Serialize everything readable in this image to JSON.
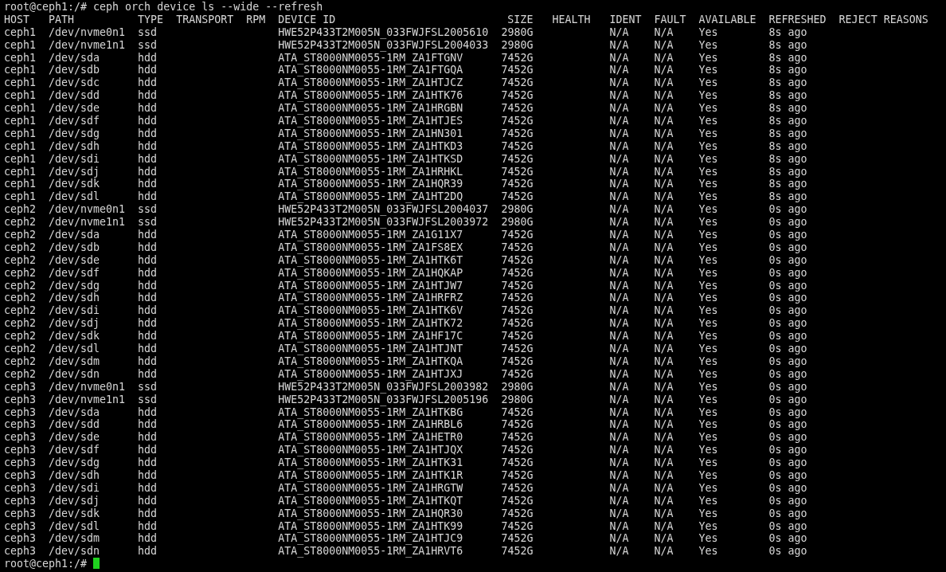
{
  "command": {
    "prompt": "root@ceph1:/#",
    "text": "ceph orch device ls --wide --refresh"
  },
  "columns": [
    "HOST",
    "PATH",
    "TYPE",
    "TRANSPORT",
    "RPM",
    "DEVICE ID",
    "SIZE",
    "HEALTH",
    "IDENT",
    "FAULT",
    "AVAILABLE",
    "REFRESHED",
    "REJECT REASONS"
  ],
  "rows": [
    {
      "host": "ceph1",
      "path": "/dev/nvme0n1",
      "type": "ssd",
      "device_id": "HWE52P433T2M005N_033FWJFSL2005610",
      "size": "2980G",
      "ident": "N/A",
      "fault": "N/A",
      "available": "Yes",
      "refreshed": "8s ago"
    },
    {
      "host": "ceph1",
      "path": "/dev/nvme1n1",
      "type": "ssd",
      "device_id": "HWE52P433T2M005N_033FWJFSL2004033",
      "size": "2980G",
      "ident": "N/A",
      "fault": "N/A",
      "available": "Yes",
      "refreshed": "8s ago"
    },
    {
      "host": "ceph1",
      "path": "/dev/sda",
      "type": "hdd",
      "device_id": "ATA_ST8000NM0055-1RM_ZA1FTGNV",
      "size": "7452G",
      "ident": "N/A",
      "fault": "N/A",
      "available": "Yes",
      "refreshed": "8s ago"
    },
    {
      "host": "ceph1",
      "path": "/dev/sdb",
      "type": "hdd",
      "device_id": "ATA_ST8000NM0055-1RM_ZA1FTGQA",
      "size": "7452G",
      "ident": "N/A",
      "fault": "N/A",
      "available": "Yes",
      "refreshed": "8s ago"
    },
    {
      "host": "ceph1",
      "path": "/dev/sdc",
      "type": "hdd",
      "device_id": "ATA_ST8000NM0055-1RM_ZA1HTJCZ",
      "size": "7452G",
      "ident": "N/A",
      "fault": "N/A",
      "available": "Yes",
      "refreshed": "8s ago"
    },
    {
      "host": "ceph1",
      "path": "/dev/sdd",
      "type": "hdd",
      "device_id": "ATA_ST8000NM0055-1RM_ZA1HTK76",
      "size": "7452G",
      "ident": "N/A",
      "fault": "N/A",
      "available": "Yes",
      "refreshed": "8s ago"
    },
    {
      "host": "ceph1",
      "path": "/dev/sde",
      "type": "hdd",
      "device_id": "ATA_ST8000NM0055-1RM_ZA1HRGBN",
      "size": "7452G",
      "ident": "N/A",
      "fault": "N/A",
      "available": "Yes",
      "refreshed": "8s ago"
    },
    {
      "host": "ceph1",
      "path": "/dev/sdf",
      "type": "hdd",
      "device_id": "ATA_ST8000NM0055-1RM_ZA1HTJES",
      "size": "7452G",
      "ident": "N/A",
      "fault": "N/A",
      "available": "Yes",
      "refreshed": "8s ago"
    },
    {
      "host": "ceph1",
      "path": "/dev/sdg",
      "type": "hdd",
      "device_id": "ATA_ST8000NM0055-1RM_ZA1HN301",
      "size": "7452G",
      "ident": "N/A",
      "fault": "N/A",
      "available": "Yes",
      "refreshed": "8s ago"
    },
    {
      "host": "ceph1",
      "path": "/dev/sdh",
      "type": "hdd",
      "device_id": "ATA_ST8000NM0055-1RM_ZA1HTKD3",
      "size": "7452G",
      "ident": "N/A",
      "fault": "N/A",
      "available": "Yes",
      "refreshed": "8s ago"
    },
    {
      "host": "ceph1",
      "path": "/dev/sdi",
      "type": "hdd",
      "device_id": "ATA_ST8000NM0055-1RM_ZA1HTKSD",
      "size": "7452G",
      "ident": "N/A",
      "fault": "N/A",
      "available": "Yes",
      "refreshed": "8s ago"
    },
    {
      "host": "ceph1",
      "path": "/dev/sdj",
      "type": "hdd",
      "device_id": "ATA_ST8000NM0055-1RM_ZA1HRHKL",
      "size": "7452G",
      "ident": "N/A",
      "fault": "N/A",
      "available": "Yes",
      "refreshed": "8s ago"
    },
    {
      "host": "ceph1",
      "path": "/dev/sdk",
      "type": "hdd",
      "device_id": "ATA_ST8000NM0055-1RM_ZA1HQR39",
      "size": "7452G",
      "ident": "N/A",
      "fault": "N/A",
      "available": "Yes",
      "refreshed": "8s ago"
    },
    {
      "host": "ceph1",
      "path": "/dev/sdl",
      "type": "hdd",
      "device_id": "ATA_ST8000NM0055-1RM_ZA1HT2DQ",
      "size": "7452G",
      "ident": "N/A",
      "fault": "N/A",
      "available": "Yes",
      "refreshed": "8s ago"
    },
    {
      "host": "ceph2",
      "path": "/dev/nvme0n1",
      "type": "ssd",
      "device_id": "HWE52P433T2M005N_033FWJFSL2004037",
      "size": "2980G",
      "ident": "N/A",
      "fault": "N/A",
      "available": "Yes",
      "refreshed": "0s ago"
    },
    {
      "host": "ceph2",
      "path": "/dev/nvme1n1",
      "type": "ssd",
      "device_id": "HWE52P433T2M005N_033FWJFSL2003972",
      "size": "2980G",
      "ident": "N/A",
      "fault": "N/A",
      "available": "Yes",
      "refreshed": "0s ago"
    },
    {
      "host": "ceph2",
      "path": "/dev/sda",
      "type": "hdd",
      "device_id": "ATA_ST8000NM0055-1RM_ZA1G11X7",
      "size": "7452G",
      "ident": "N/A",
      "fault": "N/A",
      "available": "Yes",
      "refreshed": "0s ago"
    },
    {
      "host": "ceph2",
      "path": "/dev/sdb",
      "type": "hdd",
      "device_id": "ATA_ST8000NM0055-1RM_ZA1FS8EX",
      "size": "7452G",
      "ident": "N/A",
      "fault": "N/A",
      "available": "Yes",
      "refreshed": "0s ago"
    },
    {
      "host": "ceph2",
      "path": "/dev/sde",
      "type": "hdd",
      "device_id": "ATA_ST8000NM0055-1RM_ZA1HTK6T",
      "size": "7452G",
      "ident": "N/A",
      "fault": "N/A",
      "available": "Yes",
      "refreshed": "0s ago"
    },
    {
      "host": "ceph2",
      "path": "/dev/sdf",
      "type": "hdd",
      "device_id": "ATA_ST8000NM0055-1RM_ZA1HQKAP",
      "size": "7452G",
      "ident": "N/A",
      "fault": "N/A",
      "available": "Yes",
      "refreshed": "0s ago"
    },
    {
      "host": "ceph2",
      "path": "/dev/sdg",
      "type": "hdd",
      "device_id": "ATA_ST8000NM0055-1RM_ZA1HTJW7",
      "size": "7452G",
      "ident": "N/A",
      "fault": "N/A",
      "available": "Yes",
      "refreshed": "0s ago"
    },
    {
      "host": "ceph2",
      "path": "/dev/sdh",
      "type": "hdd",
      "device_id": "ATA_ST8000NM0055-1RM_ZA1HRFRZ",
      "size": "7452G",
      "ident": "N/A",
      "fault": "N/A",
      "available": "Yes",
      "refreshed": "0s ago"
    },
    {
      "host": "ceph2",
      "path": "/dev/sdi",
      "type": "hdd",
      "device_id": "ATA_ST8000NM0055-1RM_ZA1HTK6V",
      "size": "7452G",
      "ident": "N/A",
      "fault": "N/A",
      "available": "Yes",
      "refreshed": "0s ago"
    },
    {
      "host": "ceph2",
      "path": "/dev/sdj",
      "type": "hdd",
      "device_id": "ATA_ST8000NM0055-1RM_ZA1HTK72",
      "size": "7452G",
      "ident": "N/A",
      "fault": "N/A",
      "available": "Yes",
      "refreshed": "0s ago"
    },
    {
      "host": "ceph2",
      "path": "/dev/sdk",
      "type": "hdd",
      "device_id": "ATA_ST8000NM0055-1RM_ZA1HF17C",
      "size": "7452G",
      "ident": "N/A",
      "fault": "N/A",
      "available": "Yes",
      "refreshed": "0s ago"
    },
    {
      "host": "ceph2",
      "path": "/dev/sdl",
      "type": "hdd",
      "device_id": "ATA_ST8000NM0055-1RM_ZA1HTJNT",
      "size": "7452G",
      "ident": "N/A",
      "fault": "N/A",
      "available": "Yes",
      "refreshed": "0s ago"
    },
    {
      "host": "ceph2",
      "path": "/dev/sdm",
      "type": "hdd",
      "device_id": "ATA_ST8000NM0055-1RM_ZA1HTKQA",
      "size": "7452G",
      "ident": "N/A",
      "fault": "N/A",
      "available": "Yes",
      "refreshed": "0s ago"
    },
    {
      "host": "ceph2",
      "path": "/dev/sdn",
      "type": "hdd",
      "device_id": "ATA_ST8000NM0055-1RM_ZA1HTJXJ",
      "size": "7452G",
      "ident": "N/A",
      "fault": "N/A",
      "available": "Yes",
      "refreshed": "0s ago"
    },
    {
      "host": "ceph3",
      "path": "/dev/nvme0n1",
      "type": "ssd",
      "device_id": "HWE52P433T2M005N_033FWJFSL2003982",
      "size": "2980G",
      "ident": "N/A",
      "fault": "N/A",
      "available": "Yes",
      "refreshed": "0s ago"
    },
    {
      "host": "ceph3",
      "path": "/dev/nvme1n1",
      "type": "ssd",
      "device_id": "HWE52P433T2M005N_033FWJFSL2005196",
      "size": "2980G",
      "ident": "N/A",
      "fault": "N/A",
      "available": "Yes",
      "refreshed": "0s ago"
    },
    {
      "host": "ceph3",
      "path": "/dev/sda",
      "type": "hdd",
      "device_id": "ATA_ST8000NM0055-1RM_ZA1HTKBG",
      "size": "7452G",
      "ident": "N/A",
      "fault": "N/A",
      "available": "Yes",
      "refreshed": "0s ago"
    },
    {
      "host": "ceph3",
      "path": "/dev/sdd",
      "type": "hdd",
      "device_id": "ATA_ST8000NM0055-1RM_ZA1HRBL6",
      "size": "7452G",
      "ident": "N/A",
      "fault": "N/A",
      "available": "Yes",
      "refreshed": "0s ago"
    },
    {
      "host": "ceph3",
      "path": "/dev/sde",
      "type": "hdd",
      "device_id": "ATA_ST8000NM0055-1RM_ZA1HETR0",
      "size": "7452G",
      "ident": "N/A",
      "fault": "N/A",
      "available": "Yes",
      "refreshed": "0s ago"
    },
    {
      "host": "ceph3",
      "path": "/dev/sdf",
      "type": "hdd",
      "device_id": "ATA_ST8000NM0055-1RM_ZA1HTJQX",
      "size": "7452G",
      "ident": "N/A",
      "fault": "N/A",
      "available": "Yes",
      "refreshed": "0s ago"
    },
    {
      "host": "ceph3",
      "path": "/dev/sdg",
      "type": "hdd",
      "device_id": "ATA_ST8000NM0055-1RM_ZA1HTK31",
      "size": "7452G",
      "ident": "N/A",
      "fault": "N/A",
      "available": "Yes",
      "refreshed": "0s ago"
    },
    {
      "host": "ceph3",
      "path": "/dev/sdh",
      "type": "hdd",
      "device_id": "ATA_ST8000NM0055-1RM_ZA1HTK1R",
      "size": "7452G",
      "ident": "N/A",
      "fault": "N/A",
      "available": "Yes",
      "refreshed": "0s ago"
    },
    {
      "host": "ceph3",
      "path": "/dev/sdi",
      "type": "hdd",
      "device_id": "ATA_ST8000NM0055-1RM_ZA1HRGTW",
      "size": "7452G",
      "ident": "N/A",
      "fault": "N/A",
      "available": "Yes",
      "refreshed": "0s ago"
    },
    {
      "host": "ceph3",
      "path": "/dev/sdj",
      "type": "hdd",
      "device_id": "ATA_ST8000NM0055-1RM_ZA1HTKQT",
      "size": "7452G",
      "ident": "N/A",
      "fault": "N/A",
      "available": "Yes",
      "refreshed": "0s ago"
    },
    {
      "host": "ceph3",
      "path": "/dev/sdk",
      "type": "hdd",
      "device_id": "ATA_ST8000NM0055-1RM_ZA1HQR30",
      "size": "7452G",
      "ident": "N/A",
      "fault": "N/A",
      "available": "Yes",
      "refreshed": "0s ago"
    },
    {
      "host": "ceph3",
      "path": "/dev/sdl",
      "type": "hdd",
      "device_id": "ATA_ST8000NM0055-1RM_ZA1HTK99",
      "size": "7452G",
      "ident": "N/A",
      "fault": "N/A",
      "available": "Yes",
      "refreshed": "0s ago"
    },
    {
      "host": "ceph3",
      "path": "/dev/sdm",
      "type": "hdd",
      "device_id": "ATA_ST8000NM0055-1RM_ZA1HTJC9",
      "size": "7452G",
      "ident": "N/A",
      "fault": "N/A",
      "available": "Yes",
      "refreshed": "0s ago"
    },
    {
      "host": "ceph3",
      "path": "/dev/sdn",
      "type": "hdd",
      "device_id": "ATA_ST8000NM0055-1RM_ZA1HRVT6",
      "size": "7452G",
      "ident": "N/A",
      "fault": "N/A",
      "available": "Yes",
      "refreshed": "0s ago"
    }
  ],
  "final_prompt": {
    "prompt": "root@ceph1:/#"
  }
}
